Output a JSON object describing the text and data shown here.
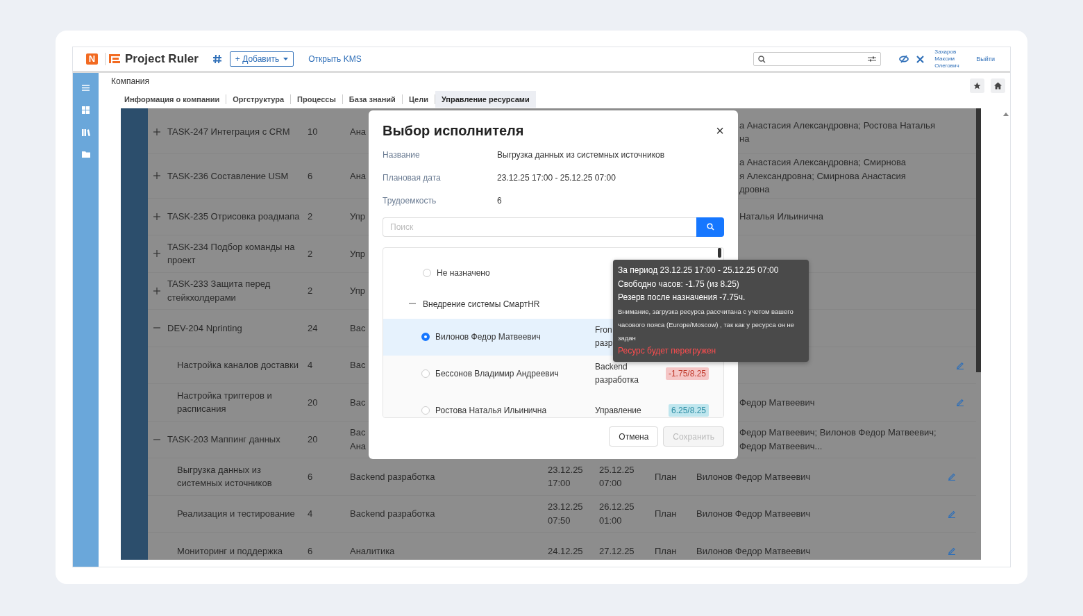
{
  "header": {
    "logo_mark": "N",
    "app_name": "Project Ruler",
    "add_button": "+ Добавить",
    "kms_link": "Открыть KMS",
    "user_name": "Захаров Максим Олегович",
    "logout": "Выйти"
  },
  "breadcrumb": "Компания",
  "tabs": [
    {
      "label": "Информация о компании",
      "selected": false
    },
    {
      "label": "Оргструктура",
      "selected": false
    },
    {
      "label": "Процессы",
      "selected": false
    },
    {
      "label": "База знаний",
      "selected": false
    },
    {
      "label": "Цели",
      "selected": false
    },
    {
      "label": "Управление ресурсами",
      "selected": true
    }
  ],
  "table": {
    "rows": [
      {
        "kind": "parent",
        "expanded": false,
        "name": "TASK-247 Интеграция с CRM",
        "hours": "10",
        "column_3": "Ана",
        "assignee": "а Анастасия Александровна; Ростова Наталья\nна",
        "editable": false
      },
      {
        "kind": "parent",
        "expanded": false,
        "name": "TASK-236 Составление USM",
        "hours": "6",
        "column_3": "Ана",
        "assignee": "а Анастасия Александровна; Смирнова\nя Александровна; Смирнова Анастасия\nдровна",
        "editable": false
      },
      {
        "kind": "parent",
        "expanded": false,
        "name": "TASK-235 Отрисовка роадмапа",
        "hours": "2",
        "column_3": "Упр",
        "assignee": "Наталья Ильинична",
        "editable": false
      },
      {
        "kind": "parent",
        "expanded": false,
        "name": "TASK-234 Подбор команды на проект",
        "hours": "2",
        "column_3": "Упр",
        "editable": false
      },
      {
        "kind": "parent",
        "expanded": false,
        "name": "TASK-233 Защита перед стейкхолдерами",
        "hours": "2",
        "column_3": "Упр",
        "editable": false
      },
      {
        "kind": "parent",
        "expanded": true,
        "name": "DEV-204 Nprinting",
        "hours": "24",
        "column_3": "Bac",
        "editable": false
      },
      {
        "kind": "child",
        "name": "Настройка каналов доставки",
        "hours": "4",
        "column_3": "Bac",
        "editable": true
      },
      {
        "kind": "child",
        "name": "Настройка триггеров и расписания",
        "hours": "20",
        "column_3": "Bac",
        "assignee": "Федор Матвеевич",
        "editable": true
      },
      {
        "kind": "parent",
        "expanded": true,
        "name": "TASK-203 Маппинг данных",
        "hours": "20",
        "column_3": "Bac\nАна",
        "assignee": "Федор Матвеевич; Вилонов Федор Матвеевич;\nФедор Матвеевич...",
        "editable": false
      },
      {
        "kind": "child",
        "name": "Выгрузка данных из системных источников",
        "hours": "6",
        "column_3": "Backend разработка",
        "start": "23.12.25\n17:00",
        "end": "25.12.25\n07:00",
        "status": "План",
        "assignee": "Вилонов Федор Матвеевич",
        "editable": true
      },
      {
        "kind": "child",
        "name": "Реализация и тестирование",
        "hours": "4",
        "column_3": "Backend разработка",
        "start": "23.12.25\n07:50",
        "end": "26.12.25\n01:00",
        "status": "План",
        "assignee": "Вилонов Федор Матвеевич",
        "editable": true
      },
      {
        "kind": "child",
        "name": "Мониторинг и поддержка",
        "hours": "6",
        "column_3": "Аналитика",
        "start": "24.12.25",
        "end": "27.12.25",
        "status": "План",
        "assignee": "Вилонов Федор Матвеевич",
        "editable": true
      }
    ]
  },
  "modal": {
    "title": "Выбор исполнителя",
    "close": "×",
    "fields": [
      {
        "label": "Название",
        "value": "Выгрузка данных из системных источников"
      },
      {
        "label": "Плановая дата",
        "value": "23.12.25 17:00 - 25.12.25 07:00"
      },
      {
        "label": "Трудоемкость",
        "value": "6"
      }
    ],
    "search": {
      "placeholder": "Поиск"
    },
    "items": [
      {
        "kind": "option",
        "name": "Не назначено",
        "selected": false
      },
      {
        "kind": "group",
        "name": "Внедрение системы СмартHR",
        "expanded": true
      },
      {
        "kind": "person",
        "name": "Вилонов Федор Матвеевич",
        "department": "Fron\nразр",
        "selected": true
      },
      {
        "kind": "person",
        "name": "Бессонов Владимир Андреевич",
        "department": "Backend\nразработка",
        "load": "-1.75/8.25",
        "overloaded": true,
        "selected": false
      },
      {
        "kind": "person",
        "name": "Ростова Наталья Ильинична",
        "department": "Управление",
        "load": "6.25/8.25",
        "overloaded": false,
        "selected": false
      }
    ],
    "buttons": [
      {
        "label": "Отмена",
        "disabled": false
      },
      {
        "label": "Сохранить",
        "disabled": true
      }
    ]
  },
  "tooltip": {
    "lines": [
      "За период 23.12.25 17:00 - 25.12.25 07:00",
      "Свободно часов: -1.75 (из 8.25)",
      "Резерв после назначения -7.75ч."
    ],
    "note": "Внимание, загрузка ресурса рассчитана с учетом вашего часового пояса (Europe/Moscow) , так как у ресурса он не задан",
    "warning": "Ресурс будет перегружен"
  }
}
